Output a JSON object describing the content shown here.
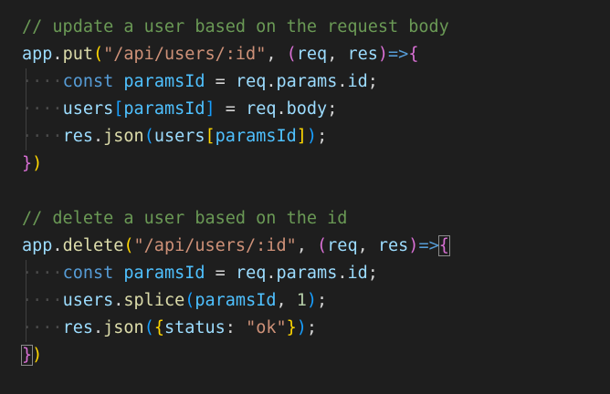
{
  "colors": {
    "background": "#1e1e1e",
    "comment": "#6a9955",
    "keyword": "#569cd6",
    "variable": "#9cdcfe",
    "function": "#dcdcaa",
    "string": "#ce9178",
    "number": "#b5cea8",
    "punctuation": "#d4d4d4",
    "bracket_gold": "#ffd700",
    "bracket_purple": "#da70d6",
    "bracket_blue": "#179fff",
    "whitespace": "#4a4a4a"
  },
  "editor": {
    "lines": [
      {
        "indent": false,
        "tokens": [
          {
            "text": "// update a user based on the request body",
            "color": "#6a9955"
          }
        ]
      },
      {
        "indent": false,
        "tokens": [
          {
            "text": "app",
            "color": "#9cdcfe"
          },
          {
            "text": ".",
            "color": "#d4d4d4"
          },
          {
            "text": "put",
            "color": "#dcdcaa"
          },
          {
            "text": "(",
            "color": "#ffd700"
          },
          {
            "text": "\"/api/users/:id\"",
            "color": "#ce9178"
          },
          {
            "text": ", ",
            "color": "#d4d4d4"
          },
          {
            "text": "(",
            "color": "#da70d6"
          },
          {
            "text": "req",
            "color": "#9cdcfe"
          },
          {
            "text": ", ",
            "color": "#d4d4d4"
          },
          {
            "text": "res",
            "color": "#9cdcfe"
          },
          {
            "text": ")",
            "color": "#da70d6"
          },
          {
            "text": "=>",
            "color": "#569cd6"
          },
          {
            "text": "{",
            "color": "#da70d6"
          }
        ]
      },
      {
        "indent": true,
        "tokens": [
          {
            "text": "const",
            "color": "#569cd6"
          },
          {
            "text": " ",
            "color": "#d4d4d4"
          },
          {
            "text": "paramsId",
            "color": "#4fc1ff"
          },
          {
            "text": " = ",
            "color": "#d4d4d4"
          },
          {
            "text": "req",
            "color": "#9cdcfe"
          },
          {
            "text": ".",
            "color": "#d4d4d4"
          },
          {
            "text": "params",
            "color": "#9cdcfe"
          },
          {
            "text": ".",
            "color": "#d4d4d4"
          },
          {
            "text": "id",
            "color": "#9cdcfe"
          },
          {
            "text": ";",
            "color": "#d4d4d4"
          }
        ]
      },
      {
        "indent": true,
        "tokens": [
          {
            "text": "users",
            "color": "#9cdcfe"
          },
          {
            "text": "[",
            "color": "#179fff"
          },
          {
            "text": "paramsId",
            "color": "#4fc1ff"
          },
          {
            "text": "]",
            "color": "#179fff"
          },
          {
            "text": " = ",
            "color": "#d4d4d4"
          },
          {
            "text": "req",
            "color": "#9cdcfe"
          },
          {
            "text": ".",
            "color": "#d4d4d4"
          },
          {
            "text": "body",
            "color": "#9cdcfe"
          },
          {
            "text": ";",
            "color": "#d4d4d4"
          }
        ]
      },
      {
        "indent": true,
        "tokens": [
          {
            "text": "res",
            "color": "#9cdcfe"
          },
          {
            "text": ".",
            "color": "#d4d4d4"
          },
          {
            "text": "json",
            "color": "#dcdcaa"
          },
          {
            "text": "(",
            "color": "#179fff"
          },
          {
            "text": "users",
            "color": "#9cdcfe"
          },
          {
            "text": "[",
            "color": "#ffd700"
          },
          {
            "text": "paramsId",
            "color": "#4fc1ff"
          },
          {
            "text": "]",
            "color": "#ffd700"
          },
          {
            "text": ")",
            "color": "#179fff"
          },
          {
            "text": ";",
            "color": "#d4d4d4"
          }
        ]
      },
      {
        "indent": false,
        "tokens": [
          {
            "text": "}",
            "color": "#da70d6"
          },
          {
            "text": ")",
            "color": "#ffd700"
          }
        ]
      },
      {
        "indent": false,
        "tokens": []
      },
      {
        "indent": false,
        "tokens": [
          {
            "text": "// delete a user based on the id",
            "color": "#6a9955"
          }
        ]
      },
      {
        "indent": false,
        "tokens": [
          {
            "text": "app",
            "color": "#9cdcfe"
          },
          {
            "text": ".",
            "color": "#d4d4d4"
          },
          {
            "text": "delete",
            "color": "#dcdcaa"
          },
          {
            "text": "(",
            "color": "#ffd700"
          },
          {
            "text": "\"/api/users/:id\"",
            "color": "#ce9178"
          },
          {
            "text": ", ",
            "color": "#d4d4d4"
          },
          {
            "text": "(",
            "color": "#da70d6"
          },
          {
            "text": "req",
            "color": "#9cdcfe"
          },
          {
            "text": ", ",
            "color": "#d4d4d4"
          },
          {
            "text": "res",
            "color": "#9cdcfe"
          },
          {
            "text": ")",
            "color": "#da70d6"
          },
          {
            "text": "=>",
            "color": "#569cd6"
          },
          {
            "text": "{",
            "color": "#da70d6",
            "match": true
          }
        ]
      },
      {
        "indent": true,
        "tokens": [
          {
            "text": "const",
            "color": "#569cd6"
          },
          {
            "text": " ",
            "color": "#d4d4d4"
          },
          {
            "text": "paramsId",
            "color": "#4fc1ff"
          },
          {
            "text": " = ",
            "color": "#d4d4d4"
          },
          {
            "text": "req",
            "color": "#9cdcfe"
          },
          {
            "text": ".",
            "color": "#d4d4d4"
          },
          {
            "text": "params",
            "color": "#9cdcfe"
          },
          {
            "text": ".",
            "color": "#d4d4d4"
          },
          {
            "text": "id",
            "color": "#9cdcfe"
          },
          {
            "text": ";",
            "color": "#d4d4d4"
          }
        ]
      },
      {
        "indent": true,
        "tokens": [
          {
            "text": "users",
            "color": "#9cdcfe"
          },
          {
            "text": ".",
            "color": "#d4d4d4"
          },
          {
            "text": "splice",
            "color": "#dcdcaa"
          },
          {
            "text": "(",
            "color": "#179fff"
          },
          {
            "text": "paramsId",
            "color": "#4fc1ff"
          },
          {
            "text": ", ",
            "color": "#d4d4d4"
          },
          {
            "text": "1",
            "color": "#b5cea8"
          },
          {
            "text": ")",
            "color": "#179fff"
          },
          {
            "text": ";",
            "color": "#d4d4d4"
          }
        ]
      },
      {
        "indent": true,
        "tokens": [
          {
            "text": "res",
            "color": "#9cdcfe"
          },
          {
            "text": ".",
            "color": "#d4d4d4"
          },
          {
            "text": "json",
            "color": "#dcdcaa"
          },
          {
            "text": "(",
            "color": "#179fff"
          },
          {
            "text": "{",
            "color": "#ffd700"
          },
          {
            "text": "status",
            "color": "#9cdcfe"
          },
          {
            "text": ": ",
            "color": "#d4d4d4"
          },
          {
            "text": "\"ok\"",
            "color": "#ce9178"
          },
          {
            "text": "}",
            "color": "#ffd700"
          },
          {
            "text": ")",
            "color": "#179fff"
          },
          {
            "text": ";",
            "color": "#d4d4d4"
          }
        ]
      },
      {
        "indent": false,
        "tokens": [
          {
            "text": "}",
            "color": "#da70d6",
            "match": true
          },
          {
            "text": ")",
            "color": "#ffd700"
          }
        ]
      }
    ]
  }
}
